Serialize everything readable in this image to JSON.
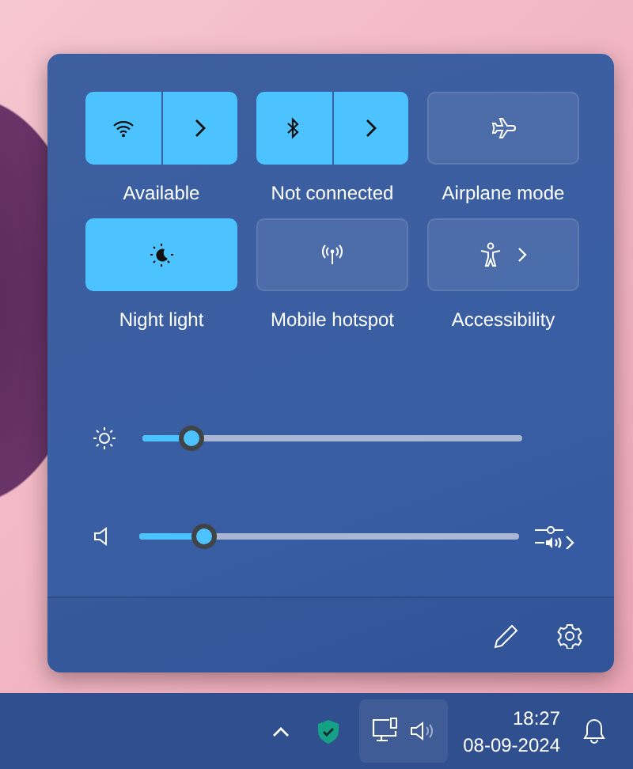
{
  "quick_settings": {
    "tiles": [
      {
        "kind": "split",
        "label": "Available",
        "on": true
      },
      {
        "kind": "split",
        "label": "Not connected",
        "on": true
      },
      {
        "kind": "toggle",
        "label": "Airplane mode",
        "on": false
      },
      {
        "kind": "toggle",
        "label": "Night light",
        "on": true
      },
      {
        "kind": "toggle",
        "label": "Mobile hotspot",
        "on": false
      },
      {
        "kind": "chevron",
        "label": "Accessibility",
        "on": false
      }
    ],
    "sliders": [
      {
        "kind": "plain",
        "level": 0.13
      },
      {
        "kind": "mixer",
        "level": 0.17
      }
    ]
  },
  "taskbar": {
    "time": "18:27",
    "date": "08-09-2024"
  }
}
